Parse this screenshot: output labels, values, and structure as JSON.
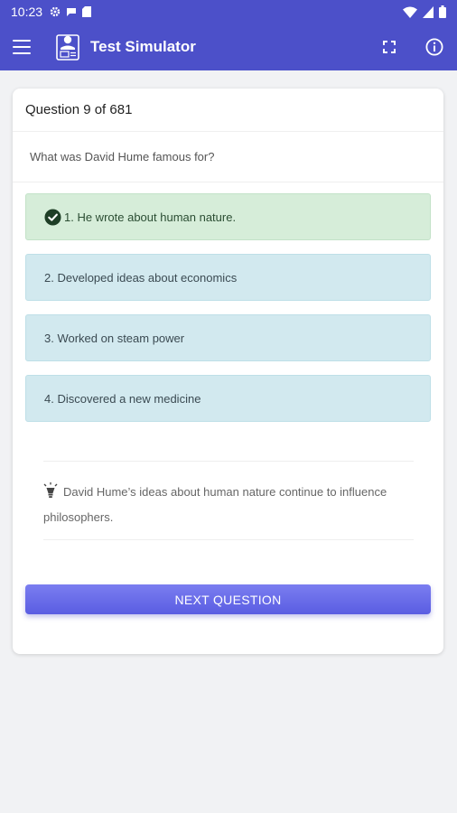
{
  "status": {
    "time": "10:23"
  },
  "appbar": {
    "title": "Test Simulator",
    "color": "#4c50c9"
  },
  "question": {
    "counter": "Question 9 of 681",
    "text": "What was David Hume famous for?"
  },
  "answers": [
    {
      "label": "1. He wrote about human nature.",
      "state": "correct"
    },
    {
      "label": "2. Developed ideas about economics",
      "state": "neutral"
    },
    {
      "label": "3. Worked on steam power",
      "state": "neutral"
    },
    {
      "label": "4. Discovered a new medicine",
      "state": "neutral"
    }
  ],
  "hint": {
    "text": "David Hume’s ideas about human nature continue to influence philosophers.",
    "icon": "lightbulb-icon"
  },
  "next_button": {
    "label": "NEXT QUESTION"
  },
  "colors": {
    "correct_bg": "#d6edd9",
    "neutral_bg": "#d2e9ef",
    "button": "#6a6de8"
  }
}
